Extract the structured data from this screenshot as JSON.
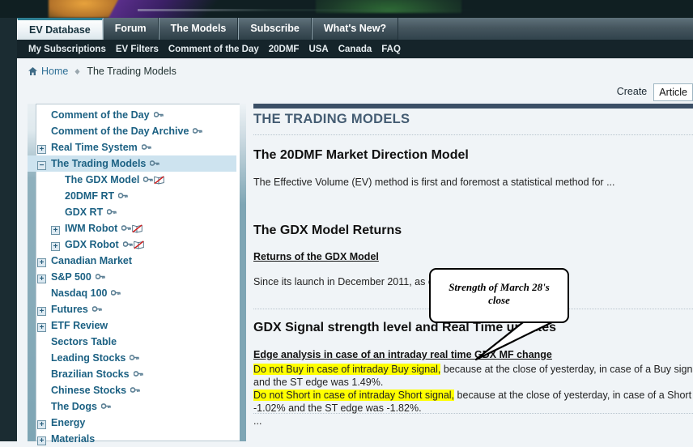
{
  "banner": {
    "alt": "site-banner-artwork"
  },
  "tabs": [
    {
      "label": "EV Database",
      "active": true
    },
    {
      "label": "Forum",
      "active": false
    },
    {
      "label": "The Models",
      "active": false
    },
    {
      "label": "Subscribe",
      "active": false
    },
    {
      "label": "What's New?",
      "active": false
    }
  ],
  "subnav": [
    "My Subscriptions",
    "EV Filters",
    "Comment of the Day",
    "20DMF",
    "USA",
    "Canada",
    "FAQ"
  ],
  "breadcrumb": {
    "home": "Home",
    "current": "The Trading Models",
    "home_icon": "home-icon",
    "separator_icon": "diamond-separator-icon"
  },
  "create": {
    "label": "Create",
    "selected": "Article",
    "options": [
      "Article"
    ]
  },
  "sidebar": {
    "items": [
      {
        "label": "Comment of the Day",
        "level": 0,
        "expander": "none",
        "key": true,
        "book": false,
        "selected": false
      },
      {
        "label": "Comment of the Day Archive",
        "level": 0,
        "expander": "none",
        "key": true,
        "book": false,
        "selected": false
      },
      {
        "label": "Real Time System",
        "level": 0,
        "expander": "plus",
        "key": true,
        "book": false,
        "selected": false
      },
      {
        "label": "The Trading Models",
        "level": 0,
        "expander": "minus",
        "key": true,
        "book": false,
        "selected": true
      },
      {
        "label": "The GDX Model",
        "level": 1,
        "expander": "none",
        "key": true,
        "book": true,
        "selected": false
      },
      {
        "label": "20DMF RT",
        "level": 1,
        "expander": "none",
        "key": true,
        "book": false,
        "selected": false
      },
      {
        "label": "GDX RT",
        "level": 1,
        "expander": "none",
        "key": true,
        "book": false,
        "selected": false
      },
      {
        "label": "IWM Robot",
        "level": 1,
        "expander": "plus",
        "key": true,
        "book": true,
        "selected": false
      },
      {
        "label": "GDX Robot",
        "level": 1,
        "expander": "plus",
        "key": true,
        "book": true,
        "selected": false
      },
      {
        "label": "Canadian Market",
        "level": 0,
        "expander": "plus",
        "key": false,
        "book": false,
        "selected": false
      },
      {
        "label": "S&P 500",
        "level": 0,
        "expander": "plus",
        "key": true,
        "book": false,
        "selected": false
      },
      {
        "label": "Nasdaq 100",
        "level": 0,
        "expander": "none",
        "key": true,
        "book": false,
        "selected": false
      },
      {
        "label": "Futures",
        "level": 0,
        "expander": "plus",
        "key": true,
        "book": false,
        "selected": false
      },
      {
        "label": "ETF Review",
        "level": 0,
        "expander": "plus",
        "key": false,
        "book": false,
        "selected": false
      },
      {
        "label": "Sectors Table",
        "level": 0,
        "expander": "none",
        "key": false,
        "book": false,
        "selected": false
      },
      {
        "label": "Leading Stocks",
        "level": 0,
        "expander": "none",
        "key": true,
        "book": false,
        "selected": false
      },
      {
        "label": "Brazilian Stocks",
        "level": 0,
        "expander": "none",
        "key": true,
        "book": false,
        "selected": false
      },
      {
        "label": "Chinese Stocks",
        "level": 0,
        "expander": "none",
        "key": true,
        "book": false,
        "selected": false
      },
      {
        "label": "The Dogs",
        "level": 0,
        "expander": "none",
        "key": true,
        "book": false,
        "selected": false
      },
      {
        "label": "Energy",
        "level": 0,
        "expander": "plus",
        "key": false,
        "book": false,
        "selected": false
      },
      {
        "label": "Materials",
        "level": 0,
        "expander": "plus",
        "key": false,
        "book": false,
        "selected": false
      }
    ]
  },
  "content": {
    "page_title": "THE TRADING MODELS",
    "sections": {
      "dmf_heading": "The 20DMF Market Direction Model",
      "dmf_text": "The Effective Volume (EV) method is first and foremost a statistical method for ...",
      "gdx_heading": "The GDX Model Returns",
      "gdx_link": "Returns of the GDX Model",
      "gdx_text": "Since its launch in December 2011, as o",
      "signal_heading": "GDX Signal strength level and Real Time updates",
      "edge_heading": "Edge analysis in case of an intraday real time GDX MF change",
      "edge_line1_hl": "Do not Buy in case of intraday Buy signal,",
      "edge_line1_rest": " because at the close of yesterday, in case of a Buy signal",
      "edge_line2": "and the ST edge was 1.49%.",
      "edge_line3_hl": "Do not Short in case of intraday Short signal,",
      "edge_line3_rest": " because at the close of yesterday, in case of a Short",
      "edge_line4": "-1.02% and the ST edge was -1.82%.",
      "edge_line5": "..."
    }
  },
  "callout": {
    "line1": "Strength of March 28's",
    "line2": "close"
  },
  "colors": {
    "highlight": "#ffff00",
    "accent_teal": "#2f7f93",
    "nav_dark": "#15242a",
    "title_blue": "#445c72",
    "tree_link": "#1c6183",
    "tree_selected_bg": "#cde3ef"
  }
}
